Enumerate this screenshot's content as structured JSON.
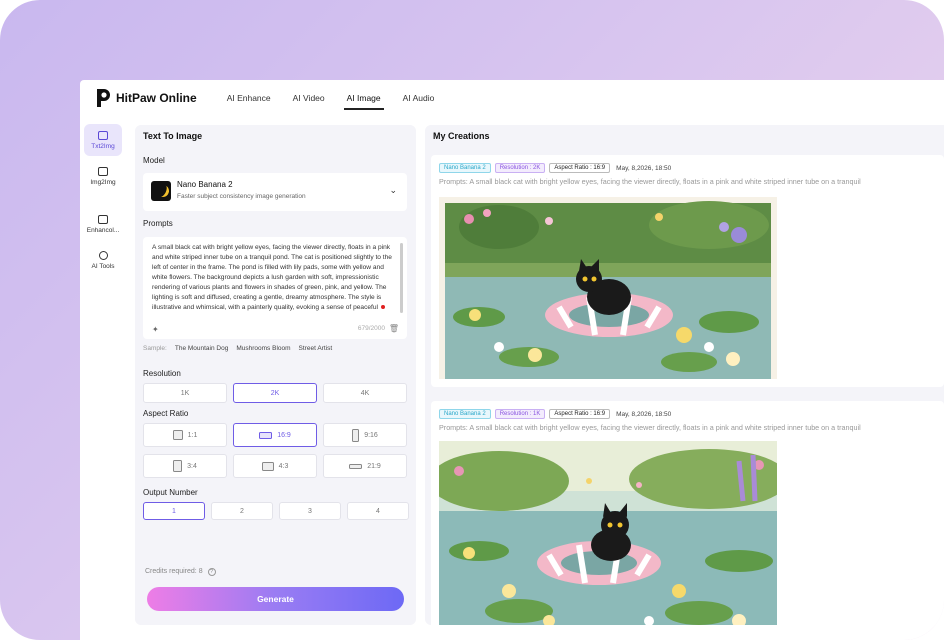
{
  "app": {
    "brand": "HitPaw Online"
  },
  "nav": {
    "items": [
      "AI Enhance",
      "AI Video",
      "AI Image",
      "AI Audio"
    ],
    "active": "AI Image"
  },
  "rail": {
    "items": [
      "Txt2Img",
      "Img2Img",
      "Enhancol...",
      "AI Tools"
    ]
  },
  "left_panel": {
    "title": "Text To Image",
    "model_label": "Model",
    "model_name": "Nano Banana 2",
    "model_desc": "Faster subject consistency image generation",
    "prompts_label": "Prompts",
    "prompt_text": "A small black cat with bright yellow eyes, facing the viewer directly, floats in a pink and white striped inner tube on a tranquil pond. The cat is positioned slightly to the left of center in the frame. The pond is filled with lily pads, some with yellow and white flowers. The background depicts a lush garden with soft, impressionistic rendering of various plants and flowers in shades of green, pink, and yellow. The lighting is soft and diffused, creating a gentle, dreamy atmosphere. The style is illustrative and whimsical, with a painterly quality, evoking a sense of peaceful",
    "char_count": "679/2000",
    "sample_label": "Sample:",
    "samples": [
      "The Mountain Dog",
      "Mushrooms Bloom",
      "Street Artist"
    ],
    "resolution_label": "Resolution",
    "resolutions": [
      "1K",
      "2K",
      "4K"
    ],
    "resolution_selected": "2K",
    "aspect_label": "Aspect Ratio",
    "aspects": [
      "1:1",
      "16:9",
      "9:16",
      "3:4",
      "4:3",
      "21:9"
    ],
    "aspect_selected": "16:9",
    "output_label": "Output Number",
    "outputs": [
      "1",
      "2",
      "3",
      "4"
    ],
    "output_selected": "1",
    "credits": "Credits required: 8",
    "generate_label": "Generate"
  },
  "creations": {
    "title": "My Creations",
    "cards": [
      {
        "model": "Nano Banana 2",
        "resolution": "Resolution : 2K",
        "aspect": "Aspect Ratio : 16:9",
        "date": "May, 8,2026, 18:50",
        "prompt": "Prompts: A small black cat with bright yellow eyes, facing the viewer directly, floats in a pink and white striped inner tube on a tranquil"
      },
      {
        "model": "Nano Banana 2",
        "resolution": "Resolution : 1K",
        "aspect": "Aspect Ratio : 16:9",
        "date": "May, 8,2026, 18:50",
        "prompt": "Prompts: A small black cat with bright yellow eyes, facing the viewer directly, floats in a pink and white striped inner tube on a tranquil"
      }
    ]
  },
  "colors": {
    "accent": "#6f5ce6",
    "panel_bg": "#f4f4f9",
    "gradient_start": "#ee7de6",
    "gradient_end": "#6d69f5"
  },
  "icons": [
    "logo-p-icon",
    "txt2img-icon",
    "img2img-icon",
    "enhance-icon",
    "ai-tools-icon",
    "chevron-down-icon",
    "magic-wand-icon",
    "trash-icon",
    "help-icon"
  ]
}
